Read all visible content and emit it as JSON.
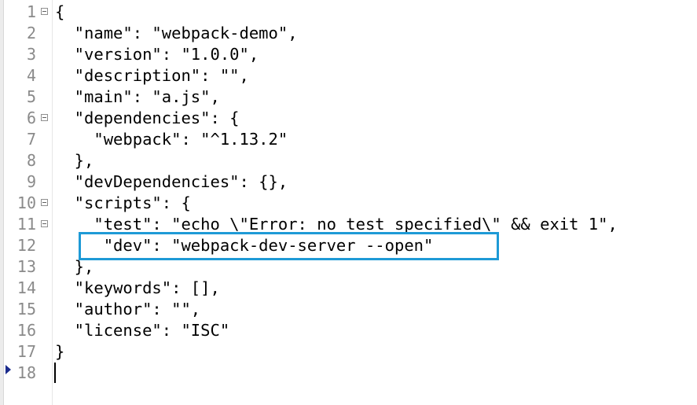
{
  "editor": {
    "lines": [
      {
        "number": "1",
        "text": "{",
        "fold": true
      },
      {
        "number": "2",
        "text": "  \"name\": \"webpack-demo\",",
        "fold": false
      },
      {
        "number": "3",
        "text": "  \"version\": \"1.0.0\",",
        "fold": false
      },
      {
        "number": "4",
        "text": "  \"description\": \"\",",
        "fold": false
      },
      {
        "number": "5",
        "text": "  \"main\": \"a.js\",",
        "fold": false
      },
      {
        "number": "6",
        "text": "  \"dependencies\": {",
        "fold": true
      },
      {
        "number": "7",
        "text": "    \"webpack\": \"^1.13.2\"",
        "fold": false
      },
      {
        "number": "8",
        "text": "  },",
        "fold": false
      },
      {
        "number": "9",
        "text": "  \"devDependencies\": {},",
        "fold": false
      },
      {
        "number": "10",
        "text": "  \"scripts\": {",
        "fold": true
      },
      {
        "number": "11",
        "text": "    \"test\": \"echo \\\"Error: no test specified\\\" && exit 1\",",
        "fold": true
      },
      {
        "number": "12",
        "text": "     \"dev\": \"webpack-dev-server --open\"",
        "fold": false
      },
      {
        "number": "13",
        "text": "  },",
        "fold": false
      },
      {
        "number": "14",
        "text": "  \"keywords\": [],",
        "fold": false
      },
      {
        "number": "15",
        "text": "  \"author\": \"\",",
        "fold": false
      },
      {
        "number": "16",
        "text": "  \"license\": \"ISC\"",
        "fold": false
      },
      {
        "number": "17",
        "text": "}",
        "fold": false
      },
      {
        "number": "18",
        "text": "",
        "fold": false
      }
    ],
    "highlight_color": "#1e9ad6",
    "current_line": "18"
  }
}
